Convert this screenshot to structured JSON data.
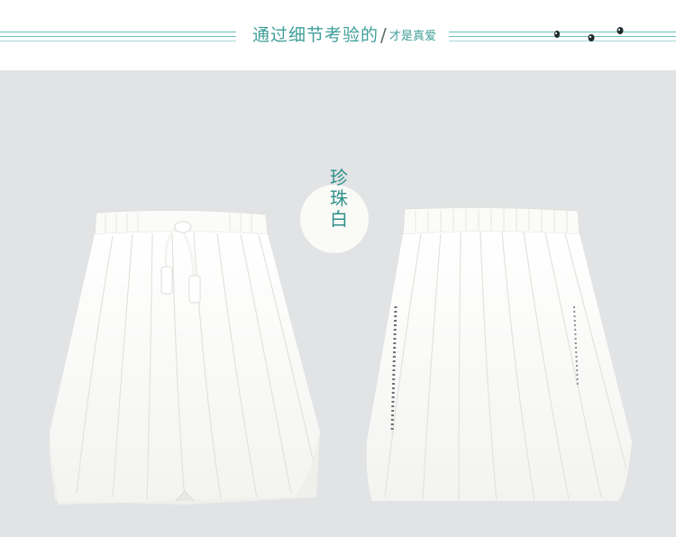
{
  "header": {
    "title_main": "通过细节考验的",
    "slash": "/",
    "title_sub": "才是真爱",
    "line_color": "#6cc0bc",
    "text_color": "#3f9f9a",
    "decoration_icon": "music-notes-icon"
  },
  "product": {
    "color_label": "珍珠白",
    "background_color": "#e2e3e5",
    "views": [
      {
        "name": "front-view-with-drawstring",
        "icon": "white-culottes-front"
      },
      {
        "name": "back-view",
        "icon": "white-culottes-back"
      }
    ]
  }
}
